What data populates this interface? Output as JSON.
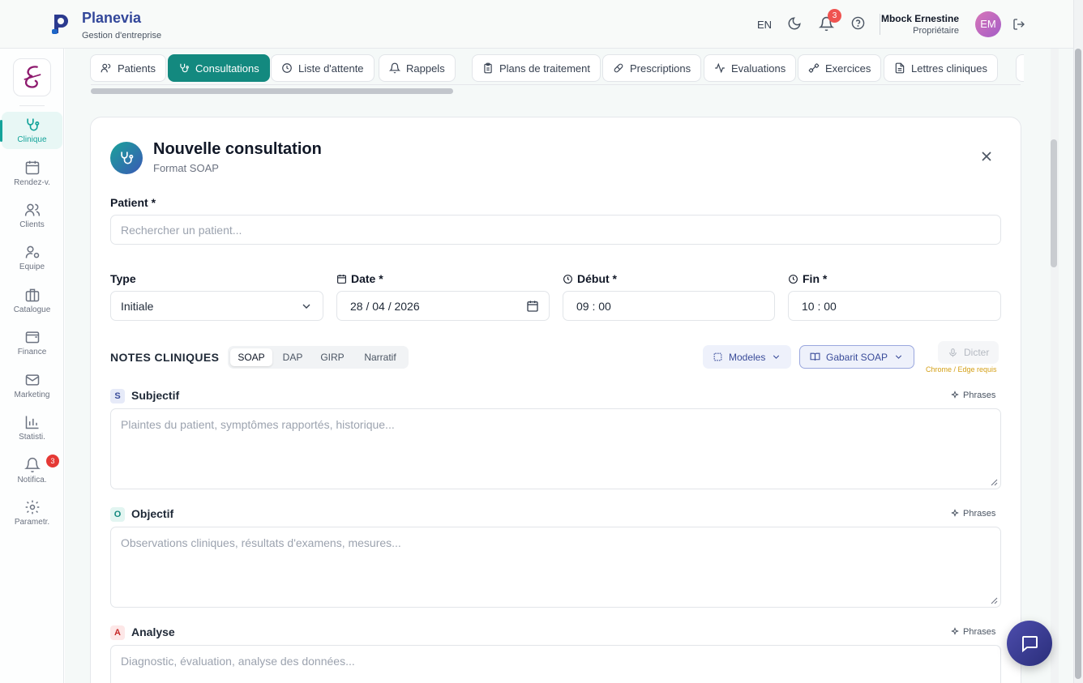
{
  "app": {
    "name": "Planevia",
    "subtitle": "Gestion d'entreprise"
  },
  "header": {
    "language": "EN",
    "notifications_count": "3",
    "user_name": "Mbock Ernestine",
    "user_role": "Propriétaire",
    "user_initials": "EM"
  },
  "sidebar": {
    "items": [
      {
        "label": "Clinique",
        "icon": "stethoscope-icon",
        "active": true
      },
      {
        "label": "Rendez-v.",
        "icon": "calendar-icon"
      },
      {
        "label": "Clients",
        "icon": "users-icon"
      },
      {
        "label": "Equipe",
        "icon": "user-cog-icon"
      },
      {
        "label": "Catalogue",
        "icon": "briefcase-icon"
      },
      {
        "label": "Finance",
        "icon": "wallet-icon"
      },
      {
        "label": "Marketing",
        "icon": "mail-icon"
      },
      {
        "label": "Statisti.",
        "icon": "bar-chart-icon"
      },
      {
        "label": "Notifica.",
        "icon": "bell-icon",
        "badge": "3"
      },
      {
        "label": "Parametr.",
        "icon": "gear-icon"
      }
    ]
  },
  "tabs": [
    {
      "label": "Patients",
      "icon": "users-icon"
    },
    {
      "label": "Consultations",
      "icon": "stethoscope-icon",
      "active": true
    },
    {
      "label": "Liste d'attente",
      "icon": "clock-icon"
    },
    {
      "label": "Rappels",
      "icon": "bell-icon"
    },
    {
      "label": "Plans de traitement",
      "icon": "clipboard-icon"
    },
    {
      "label": "Prescriptions",
      "icon": "pill-icon"
    },
    {
      "label": "Evaluations",
      "icon": "activity-icon"
    },
    {
      "label": "Exercices",
      "icon": "dumbbell-icon"
    },
    {
      "label": "Lettres cliniques",
      "icon": "file-text-icon"
    }
  ],
  "form": {
    "title": "Nouvelle consultation",
    "subtitle": "Format SOAP",
    "patient_label": "Patient *",
    "patient_placeholder": "Rechercher un patient...",
    "type_label": "Type",
    "type_value": "Initiale",
    "date_label": "Date *",
    "date_value": "28 / 04 / 2026",
    "start_label": "Début *",
    "start_value": "09 : 00",
    "end_label": "Fin *",
    "end_value": "10 : 00"
  },
  "notes": {
    "title": "NOTES CLINIQUES",
    "formats": [
      "SOAP",
      "DAP",
      "GIRP",
      "Narratif"
    ],
    "active_format": "SOAP",
    "models_label": "Modeles",
    "template_label": "Gabarit SOAP",
    "dictate_label": "Dicter",
    "browser_note": "Chrome / Edge requis",
    "phrases_label": "Phrases",
    "sections": [
      {
        "letter": "S",
        "title": "Subjectif",
        "placeholder": "Plaintes du patient, symptômes rapportés, historique...",
        "color": "#3a4c9a",
        "bg": "#e6eaf8"
      },
      {
        "letter": "O",
        "title": "Objectif",
        "placeholder": "Observations cliniques, résultats d'examens, mesures...",
        "color": "#13897f",
        "bg": "#e2f5f1"
      },
      {
        "letter": "A",
        "title": "Analyse",
        "placeholder": "Diagnostic, évaluation, analyse des données...",
        "color": "#c62828",
        "bg": "#fde7e7"
      }
    ]
  },
  "colors": {
    "brand": "#33479a",
    "accent": "#13897f",
    "danger": "#ef5350"
  }
}
